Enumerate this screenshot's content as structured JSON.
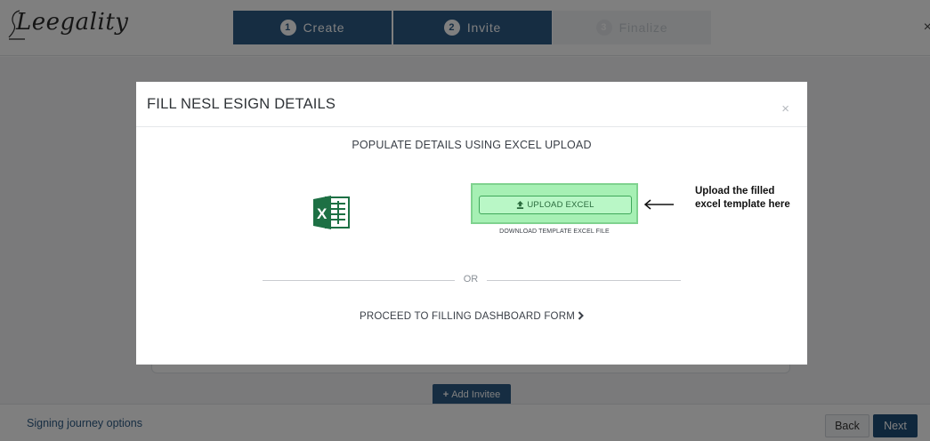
{
  "header": {
    "logo_text": "Leegality",
    "steps": [
      {
        "number": "1",
        "label": "Create",
        "state": "active"
      },
      {
        "number": "2",
        "label": "Invite",
        "state": "active"
      },
      {
        "number": "3",
        "label": "Finalize",
        "state": "inactive"
      }
    ],
    "close_symbol": "×"
  },
  "page": {
    "add_invitee_label": "Add Invitee",
    "add_invitee_icon": "+",
    "footer": {
      "journey_label": "Signing journey options",
      "back_label": "Back",
      "next_label": "Next"
    }
  },
  "modal": {
    "title": "FILL NESL ESIGN DETAILS",
    "close_symbol": "×",
    "populate_heading": "POPULATE DETAILS USING EXCEL UPLOAD",
    "excel_icon": "excel-icon",
    "upload_label": "UPLOAD EXCEL",
    "upload_icon": "upload-icon",
    "download_link": "DOWNLOAD TEMPLATE EXCEL FILE",
    "note": "Upload the filled excel template here",
    "or_text": "OR",
    "proceed_label": "PROCEED TO FILLING DASHBOARD FORM",
    "proceed_chevron": "›"
  },
  "colors": {
    "primary": "#2d5a85",
    "upload_highlight": "#a6f0b4",
    "excel_green": "#1d7044"
  }
}
